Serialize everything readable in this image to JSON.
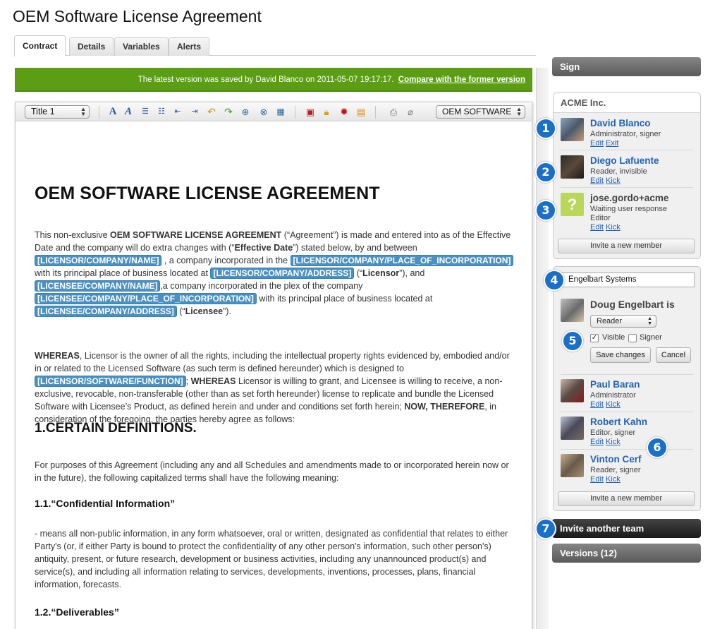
{
  "page": {
    "title": "OEM Software License Agreement"
  },
  "tabs": [
    {
      "label": "Contract"
    },
    {
      "label": "Details"
    },
    {
      "label": "Variables"
    },
    {
      "label": "Alerts"
    }
  ],
  "notice": {
    "text": "The latest version was saved by David Blanco on 2011-05-07 19:17:17.",
    "link": "Compare with the former version",
    "color": "#5b9e14"
  },
  "toolbar": {
    "style_select": "Title 1",
    "variable_select": "OEM SOFTWARE",
    "icons": [
      "font-color-icon",
      "font-italic-icon",
      "ordered-list-icon",
      "bullet-list-icon",
      "outdent-icon",
      "indent-icon",
      "undo-icon",
      "redo-icon",
      "link-icon",
      "unlink-icon",
      "table-icon",
      "save-icon",
      "lock-icon",
      "seal-icon",
      "stamp-icon",
      "print-icon",
      "attachment-icon"
    ]
  },
  "document": {
    "heading": "OEM SOFTWARE LICENSE AGREEMENT",
    "p1_a": "This non-exclusive ",
    "p1_b": "OEM SOFTWARE LICENSE AGREEMENT",
    "p1_c": " (“Agreement”) is made and entered into as of the Effective Date and the company will do extra changes with (“",
    "p1_d": "Effective Date",
    "p1_e": "”) stated below, by and between ",
    "var_licensor_name": "[LICENSOR/COMPANY/NAME]",
    "p1_f": " , a company incorporated in the ",
    "var_licensor_place": "[LICENSOR/COMPANY/PLACE_OF_INCORPORATION]",
    "p1_g": " with its principal place of business located at ",
    "var_licensor_address": "[LICENSOR/COMPANY/ADDRESS]",
    "p1_h": " (“",
    "p1_i": "Licensor",
    "p1_j": "”), and ",
    "var_licensee_name": "[LICENSEE/COMPANY/NAME]",
    "p1_k": ",a company incorporated in the plex of the company ",
    "var_licensee_place": "[LICENSEE/COMPANY/PLACE_OF_INCORPORATION]",
    "p1_l": " with its principal place of business located at ",
    "var_licensee_address": "[LICENSEE/COMPANY/ADDRESS]",
    "p1_m": " (“",
    "p1_n": "Licensee",
    "p1_o": "”).",
    "p2_a": "WHEREAS",
    "p2_b": ", Licensor is the owner of all the rights, including the intellectual property rights evidenced by, embodied and/or in or related to the Licensed Software (as such term is defined hereunder) which is designed to ",
    "var_software_function": "[LICENSOR/SOFTWARE/FUNCTION]",
    "p2_c": "; ",
    "p2_d": "WHEREAS",
    "p2_e": " Licensor is willing to grant, and Licensee is willing to receive, a non-exclusive, revocable, non-transferable (other than as set forth hereunder) license to replicate and bundle the Licensed Software with Licensee’s Product, as defined herein and under and conditions set forth herein; ",
    "p2_f": "NOW, THEREFORE",
    "p2_g": ", in consideration of the foregoing, the parties hereby agree as follows:",
    "section1": "1.CERTAIN DEFINITIONS.",
    "p3": "For purposes of this Agreement (including any and all Schedules and amendments made to or incorporated herein now or in the future), the following capitalized terms shall have the following meaning:",
    "section11": "1.1.“Confidential Information”",
    "p4": "- means all non-public information, in any form whatsoever, oral or written, designated as confidential that relates to either Party's (or, if either Party is bound to protect the confidentiality of any other person's information, such other person's) antiquity, present, or future research, development or business activities, including any unannounced product(s) and service(s), and including all information relating to services, developments, inventions, processes, plans, financial information, forecasts.",
    "section12": "1.2.“Deliverables”"
  },
  "sidebar": {
    "sign_label": "Sign",
    "team1": {
      "name": "ACME Inc.",
      "members": [
        {
          "name": "David Blanco",
          "role": "Administrator, signer",
          "links": [
            "Edit",
            "Exit"
          ]
        },
        {
          "name": "Diego Lafuente",
          "role": "Reader, invisible",
          "links": [
            "Edit",
            "Kick"
          ]
        },
        {
          "name": "jose.gordo+acme",
          "role": "Waiting user response",
          "role2": "Editor",
          "links": [
            "Edit",
            "Kick"
          ]
        }
      ],
      "invite_label": "Invite a new member"
    },
    "team2": {
      "name_input": "Engelbart Systems",
      "editing_name": "Doug Engelbart is",
      "role_select": "Reader",
      "visible_label": "Visible",
      "signer_label": "Signer",
      "save_label": "Save changes",
      "cancel_label": "Cancel",
      "members": [
        {
          "name": "Paul Baran",
          "role": "Administrator",
          "links": [
            "Edit",
            "Kick"
          ]
        },
        {
          "name": "Robert Kahn",
          "role": "Editor, signer",
          "links": [
            "Edit",
            "Kick"
          ]
        },
        {
          "name": "Vinton Cerf",
          "role": "Reader, signer",
          "links": [
            "Edit",
            "Kick"
          ]
        }
      ],
      "invite_label": "Invite a new member"
    },
    "invite_team_label": "Invite another team",
    "versions_label": "Versions (12)"
  },
  "callouts": [
    "1",
    "2",
    "3",
    "4",
    "5",
    "6",
    "7"
  ],
  "colors": {
    "accent_blue": "#1a6fc9",
    "link": "#2262b5",
    "variable": "#4a90c2"
  }
}
